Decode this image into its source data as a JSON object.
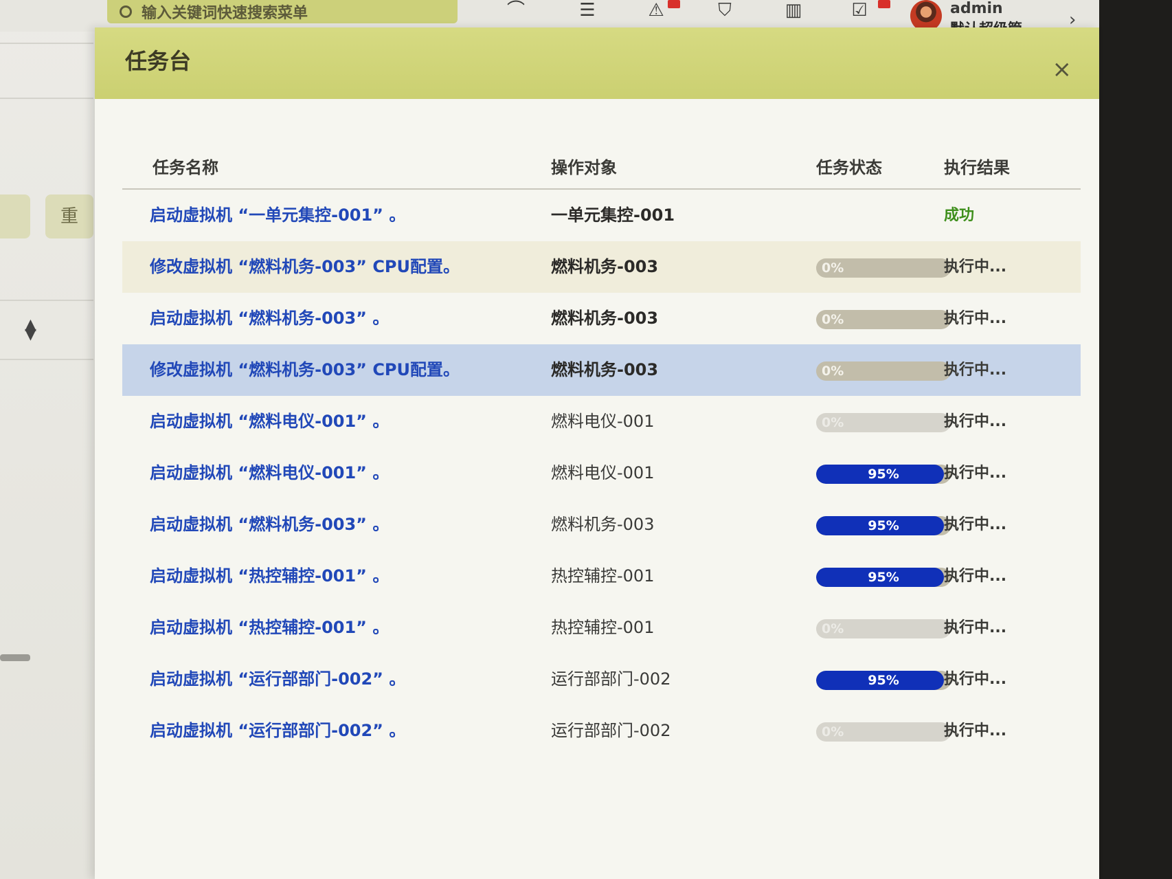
{
  "topbar": {
    "search_placeholder": "输入关键词快速搜索菜单",
    "user_name": "admin",
    "user_role": "默认超级管..."
  },
  "background": {
    "left_buttons": [
      "",
      "重"
    ]
  },
  "modal": {
    "title": "任务台",
    "close_label": "×",
    "columns": [
      "任务名称",
      "操作对象",
      "任务状态",
      "执行结果"
    ],
    "rows": [
      {
        "name": "启动虚拟机 “一单元集控-001” 。",
        "target": "一单元集控-001",
        "progress": null,
        "progress_label": "",
        "result": "成功"
      },
      {
        "name": "修改虚拟机 “燃料机务-003” CPU配置。",
        "target": "燃料机务-003",
        "progress": 0,
        "progress_label": "0%",
        "result": "执行中..."
      },
      {
        "name": "启动虚拟机 “燃料机务-003” 。",
        "target": "燃料机务-003",
        "progress": 0,
        "progress_label": "0%",
        "result": "执行中..."
      },
      {
        "name": "修改虚拟机 “燃料机务-003” CPU配置。",
        "target": "燃料机务-003",
        "progress": 0,
        "progress_label": "0%",
        "result": "执行中..."
      },
      {
        "name": "启动虚拟机 “燃料电仪-001” 。",
        "target": "燃料电仪-001",
        "progress": 0,
        "progress_label": "0%",
        "result": "执行中..."
      },
      {
        "name": "启动虚拟机 “燃料电仪-001” 。",
        "target": "燃料电仪-001",
        "progress": 95,
        "progress_label": "95%",
        "result": "执行中..."
      },
      {
        "name": "启动虚拟机 “燃料机务-003” 。",
        "target": "燃料机务-003",
        "progress": 95,
        "progress_label": "95%",
        "result": "执行中..."
      },
      {
        "name": "启动虚拟机 “热控辅控-001” 。",
        "target": "热控辅控-001",
        "progress": 95,
        "progress_label": "95%",
        "result": "执行中..."
      },
      {
        "name": "启动虚拟机 “热控辅控-001” 。",
        "target": "热控辅控-001",
        "progress": 0,
        "progress_label": "0%",
        "result": "执行中..."
      },
      {
        "name": "启动虚拟机 “运行部部门-002” 。",
        "target": "运行部部门-002",
        "progress": 95,
        "progress_label": "95%",
        "result": "执行中..."
      },
      {
        "name": "启动虚拟机 “运行部部门-002” 。",
        "target": "运行部部门-002",
        "progress": 0,
        "progress_label": "0%",
        "result": "执行中..."
      }
    ]
  },
  "colors": {
    "header_bg": "#cfd377",
    "link_blue": "#2148b8",
    "progress_fill": "#1030b8",
    "success_green": "#3e8f1c",
    "selected_row": "#c6d4e9"
  }
}
